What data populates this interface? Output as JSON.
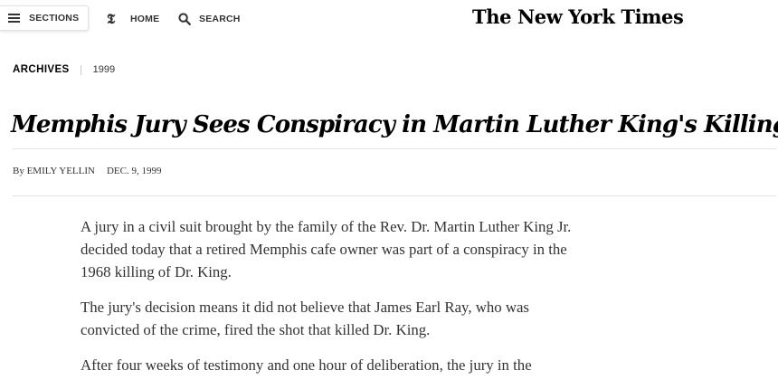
{
  "nav": {
    "sections_label": "SECTIONS",
    "home_label": "HOME",
    "search_label": "SEARCH",
    "home_icon_glyph": "𝕿",
    "masthead": "The New York Times"
  },
  "kicker": {
    "section": "ARCHIVES",
    "year": "1999"
  },
  "article": {
    "headline": "Memphis Jury Sees Conspiracy in Martin Luther King's Killing",
    "byline_author": "By EMILY YELLIN",
    "byline_date": "DEC. 9, 1999",
    "paragraphs": [
      "A jury in a civil suit brought by the family of the Rev. Dr. Martin Luther King Jr. decided today that a retired Memphis cafe owner was part of a conspiracy in the 1968 killing of Dr. King.",
      "The jury's decision means it did not believe that James Earl Ray, who was convicted of the crime, fired the shot that killed Dr. King.",
      "After four weeks of testimony and one hour of deliberation, the jury in the"
    ]
  },
  "colors": {
    "text": "#121212",
    "body_text": "#333333",
    "rule": "#e2e2e2"
  }
}
